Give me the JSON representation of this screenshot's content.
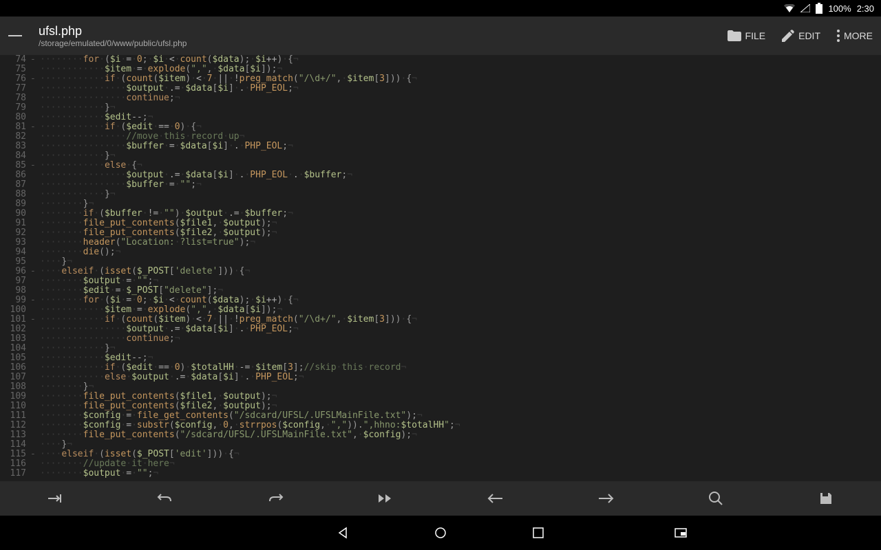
{
  "status": {
    "battery": "100%",
    "time": "2:30"
  },
  "header": {
    "title": "ufsl.php",
    "path": "/storage/emulated/0/www/public/ufsl.php",
    "actions": {
      "file": "FILE",
      "edit": "EDIT",
      "more": "MORE"
    }
  },
  "lines": [
    {
      "n": 74,
      "f": "-",
      "ind": 2,
      "html": "<span class='kw'>for</span><span class='ws'>·</span><span class='punc'>(</span><span class='var'>$i</span><span class='ws'>·</span><span class='op'>=</span><span class='ws'>·</span><span class='num'>0</span><span class='punc'>;</span><span class='ws'>·</span><span class='var'>$i</span><span class='ws'>·</span><span class='op'>&lt;</span><span class='ws'>·</span><span class='fn'>count</span><span class='punc'>(</span><span class='var'>$data</span><span class='punc'>);</span><span class='ws'>·</span><span class='var'>$i</span><span class='op'>++</span><span class='punc'>)</span><span class='ws'>·</span><span class='punc'>{</span><span class='nl'>¬</span>"
    },
    {
      "n": 75,
      "f": "",
      "ind": 3,
      "html": "<span class='var'>$item</span><span class='ws'>·</span><span class='op'>=</span><span class='ws'>·</span><span class='fn'>explode</span><span class='punc'>(</span><span class='str'>\",\"</span><span class='punc'>,</span><span class='ws'>·</span><span class='var'>$data</span><span class='punc'>[</span><span class='var'>$i</span><span class='punc'>]);</span><span class='nl'>¬</span>"
    },
    {
      "n": 76,
      "f": "-",
      "ind": 3,
      "html": "<span class='kw'>if</span><span class='ws'>·</span><span class='punc'>(</span><span class='fn'>count</span><span class='punc'>(</span><span class='var'>$item</span><span class='punc'>)</span><span class='ws'>·</span><span class='op'>&lt;</span><span class='ws'>·</span><span class='num'>7</span><span class='ws'>·</span><span class='op'>||</span><span class='ws'>·</span><span class='op'>!</span><span class='fn'>preg_match</span><span class='punc'>(</span><span class='str'>\"/\\d+/\"</span><span class='punc'>,</span><span class='ws'>·</span><span class='var'>$item</span><span class='punc'>[</span><span class='num'>3</span><span class='punc'>]))</span><span class='ws'>·</span><span class='punc'>{</span><span class='nl'>¬</span>"
    },
    {
      "n": 77,
      "f": "",
      "ind": 4,
      "html": "<span class='var'>$output</span><span class='ws'>·</span><span class='op'>.=</span><span class='ws'>·</span><span class='var'>$data</span><span class='punc'>[</span><span class='var'>$i</span><span class='punc'>]</span><span class='ws'>·</span><span class='op'>.</span><span class='ws'>·</span><span class='const'>PHP_EOL</span><span class='punc'>;</span><span class='nl'>¬</span>"
    },
    {
      "n": 78,
      "f": "",
      "ind": 4,
      "html": "<span class='kw'>continue</span><span class='punc'>;</span><span class='nl'>¬</span>"
    },
    {
      "n": 79,
      "f": "",
      "ind": 3,
      "html": "<span class='punc'>}</span><span class='nl'>¬</span>"
    },
    {
      "n": 80,
      "f": "",
      "ind": 3,
      "html": "<span class='var'>$edit</span><span class='op'>--</span><span class='punc'>;</span><span class='nl'>¬</span>"
    },
    {
      "n": 81,
      "f": "-",
      "ind": 3,
      "html": "<span class='kw'>if</span><span class='ws'>·</span><span class='punc'>(</span><span class='var'>$edit</span><span class='ws'>·</span><span class='op'>==</span><span class='ws'>·</span><span class='num'>0</span><span class='punc'>)</span><span class='ws'>·</span><span class='punc'>{</span><span class='nl'>¬</span>"
    },
    {
      "n": 82,
      "f": "",
      "ind": 4,
      "html": "<span class='cmt'>//move</span><span class='ws'>·</span><span class='cmt'>this</span><span class='ws'>·</span><span class='cmt'>record</span><span class='ws'>·</span><span class='cmt'>up</span><span class='nl'>¬</span>"
    },
    {
      "n": 83,
      "f": "",
      "ind": 4,
      "html": "<span class='var'>$buffer</span><span class='ws'>·</span><span class='op'>=</span><span class='ws'>·</span><span class='var'>$data</span><span class='punc'>[</span><span class='var'>$i</span><span class='punc'>]</span><span class='ws'>·</span><span class='op'>.</span><span class='ws'>·</span><span class='const'>PHP_EOL</span><span class='punc'>;</span><span class='nl'>¬</span>"
    },
    {
      "n": 84,
      "f": "",
      "ind": 3,
      "html": "<span class='punc'>}</span><span class='nl'>¬</span>"
    },
    {
      "n": 85,
      "f": "-",
      "ind": 3,
      "html": "<span class='kw'>else</span><span class='ws'>·</span><span class='punc'>{</span><span class='nl'>¬</span>"
    },
    {
      "n": 86,
      "f": "",
      "ind": 4,
      "html": "<span class='var'>$output</span><span class='ws'>·</span><span class='op'>.=</span><span class='ws'>·</span><span class='var'>$data</span><span class='punc'>[</span><span class='var'>$i</span><span class='punc'>]</span><span class='ws'>·</span><span class='op'>.</span><span class='ws'>·</span><span class='const'>PHP_EOL</span><span class='ws'>·</span><span class='op'>.</span><span class='ws'>·</span><span class='var'>$buffer</span><span class='punc'>;</span><span class='nl'>¬</span>"
    },
    {
      "n": 87,
      "f": "",
      "ind": 4,
      "html": "<span class='var'>$buffer</span><span class='ws'>·</span><span class='op'>=</span><span class='ws'>·</span><span class='str'>\"\"</span><span class='punc'>;</span><span class='nl'>¬</span>"
    },
    {
      "n": 88,
      "f": "",
      "ind": 3,
      "html": "<span class='punc'>}</span><span class='nl'>¬</span>"
    },
    {
      "n": 89,
      "f": "",
      "ind": 2,
      "html": "<span class='punc'>}</span><span class='nl'>¬</span>"
    },
    {
      "n": 90,
      "f": "",
      "ind": 2,
      "html": "<span class='kw'>if</span><span class='ws'>·</span><span class='punc'>(</span><span class='var'>$buffer</span><span class='ws'>·</span><span class='op'>!=</span><span class='ws'>·</span><span class='str'>\"\"</span><span class='punc'>)</span><span class='ws'>·</span><span class='var'>$output</span><span class='ws'>·</span><span class='op'>.=</span><span class='ws'>·</span><span class='var'>$buffer</span><span class='punc'>;</span><span class='nl'>¬</span>"
    },
    {
      "n": 91,
      "f": "",
      "ind": 2,
      "html": "<span class='fn'>file_put_contents</span><span class='punc'>(</span><span class='var'>$file1</span><span class='punc'>,</span><span class='ws'>·</span><span class='var'>$output</span><span class='punc'>);</span><span class='nl'>¬</span>"
    },
    {
      "n": 92,
      "f": "",
      "ind": 2,
      "html": "<span class='fn'>file_put_contents</span><span class='punc'>(</span><span class='var'>$file2</span><span class='punc'>,</span><span class='ws'>·</span><span class='var'>$output</span><span class='punc'>);</span><span class='nl'>¬</span>"
    },
    {
      "n": 93,
      "f": "",
      "ind": 2,
      "html": "<span class='fn'>header</span><span class='punc'>(</span><span class='str'>\"Location:</span><span class='ws'>·</span><span class='str'>?list=true\"</span><span class='punc'>);</span><span class='nl'>¬</span>"
    },
    {
      "n": 94,
      "f": "",
      "ind": 2,
      "html": "<span class='fn'>die</span><span class='punc'>();</span><span class='nl'>¬</span>"
    },
    {
      "n": 95,
      "f": "",
      "ind": 1,
      "html": "<span class='punc'>}</span><span class='nl'>¬</span>"
    },
    {
      "n": 96,
      "f": "-",
      "ind": 1,
      "html": "<span class='kw'>elseif</span><span class='ws'>·</span><span class='punc'>(</span><span class='fn'>isset</span><span class='punc'>(</span><span class='var'>$_POST</span><span class='punc'>[</span><span class='str'>'delete'</span><span class='punc'>]))</span><span class='ws'>·</span><span class='punc'>{</span><span class='nl'>¬</span>"
    },
    {
      "n": 97,
      "f": "",
      "ind": 2,
      "html": "<span class='var'>$output</span><span class='ws'>·</span><span class='op'>=</span><span class='ws'>·</span><span class='str'>\"\"</span><span class='punc'>;</span><span class='nl'>¬</span>"
    },
    {
      "n": 98,
      "f": "",
      "ind": 2,
      "html": "<span class='var'>$edit</span><span class='ws'>·</span><span class='op'>=</span><span class='ws'>·</span><span class='var'>$_POST</span><span class='punc'>[</span><span class='str'>\"delete\"</span><span class='punc'>];</span><span class='nl'>¬</span>"
    },
    {
      "n": 99,
      "f": "-",
      "ind": 2,
      "html": "<span class='kw'>for</span><span class='ws'>·</span><span class='punc'>(</span><span class='var'>$i</span><span class='ws'>·</span><span class='op'>=</span><span class='ws'>·</span><span class='num'>0</span><span class='punc'>;</span><span class='ws'>·</span><span class='var'>$i</span><span class='ws'>·</span><span class='op'>&lt;</span><span class='ws'>·</span><span class='fn'>count</span><span class='punc'>(</span><span class='var'>$data</span><span class='punc'>);</span><span class='ws'>·</span><span class='var'>$i</span><span class='op'>++</span><span class='punc'>)</span><span class='ws'>·</span><span class='punc'>{</span><span class='nl'>¬</span>"
    },
    {
      "n": 100,
      "f": "",
      "ind": 3,
      "html": "<span class='var'>$item</span><span class='ws'>·</span><span class='op'>=</span><span class='ws'>·</span><span class='fn'>explode</span><span class='punc'>(</span><span class='str'>\",\"</span><span class='punc'>,</span><span class='ws'>·</span><span class='var'>$data</span><span class='punc'>[</span><span class='var'>$i</span><span class='punc'>]);</span><span class='nl'>¬</span>"
    },
    {
      "n": 101,
      "f": "-",
      "ind": 3,
      "html": "<span class='kw'>if</span><span class='ws'>·</span><span class='punc'>(</span><span class='fn'>count</span><span class='punc'>(</span><span class='var'>$item</span><span class='punc'>)</span><span class='ws'>·</span><span class='op'>&lt;</span><span class='ws'>·</span><span class='num'>7</span><span class='ws'>·</span><span class='op'>||</span><span class='ws'>·</span><span class='op'>!</span><span class='fn'>preg_match</span><span class='punc'>(</span><span class='str'>\"/\\d+/\"</span><span class='punc'>,</span><span class='ws'>·</span><span class='var'>$item</span><span class='punc'>[</span><span class='num'>3</span><span class='punc'>]))</span><span class='ws'>·</span><span class='punc'>{</span><span class='nl'>¬</span>"
    },
    {
      "n": 102,
      "f": "",
      "ind": 4,
      "html": "<span class='var'>$output</span><span class='ws'>·</span><span class='op'>.=</span><span class='ws'>·</span><span class='var'>$data</span><span class='punc'>[</span><span class='var'>$i</span><span class='punc'>]</span><span class='ws'>·</span><span class='op'>.</span><span class='ws'>·</span><span class='const'>PHP_EOL</span><span class='punc'>;</span><span class='nl'>¬</span>"
    },
    {
      "n": 103,
      "f": "",
      "ind": 4,
      "html": "<span class='kw'>continue</span><span class='punc'>;</span><span class='nl'>¬</span>"
    },
    {
      "n": 104,
      "f": "",
      "ind": 3,
      "html": "<span class='punc'>}</span><span class='nl'>¬</span>"
    },
    {
      "n": 105,
      "f": "",
      "ind": 3,
      "html": "<span class='var'>$edit</span><span class='op'>--</span><span class='punc'>;</span><span class='nl'>¬</span>"
    },
    {
      "n": 106,
      "f": "",
      "ind": 3,
      "html": "<span class='kw'>if</span><span class='ws'>·</span><span class='punc'>(</span><span class='var'>$edit</span><span class='ws'>·</span><span class='op'>==</span><span class='ws'>·</span><span class='num'>0</span><span class='punc'>)</span><span class='ws'>·</span><span class='var'>$totalHH</span><span class='ws'>·</span><span class='op'>-=</span><span class='ws'>·</span><span class='var'>$item</span><span class='punc'>[</span><span class='num'>3</span><span class='punc'>];</span><span class='cmt'>//skip</span><span class='ws'>·</span><span class='cmt'>this</span><span class='ws'>·</span><span class='cmt'>record</span><span class='nl'>¬</span>"
    },
    {
      "n": 107,
      "f": "",
      "ind": 3,
      "html": "<span class='kw'>else</span><span class='ws'>·</span><span class='var'>$output</span><span class='ws'>·</span><span class='op'>.=</span><span class='ws'>·</span><span class='var'>$data</span><span class='punc'>[</span><span class='var'>$i</span><span class='punc'>]</span><span class='ws'>·</span><span class='op'>.</span><span class='ws'>·</span><span class='const'>PHP_EOL</span><span class='punc'>;</span><span class='nl'>¬</span>"
    },
    {
      "n": 108,
      "f": "",
      "ind": 2,
      "html": "<span class='punc'>}</span><span class='nl'>¬</span>"
    },
    {
      "n": 109,
      "f": "",
      "ind": 2,
      "html": "<span class='fn'>file_put_contents</span><span class='punc'>(</span><span class='var'>$file1</span><span class='punc'>,</span><span class='ws'>·</span><span class='var'>$output</span><span class='punc'>);</span><span class='nl'>¬</span>"
    },
    {
      "n": 110,
      "f": "",
      "ind": 2,
      "html": "<span class='fn'>file_put_contents</span><span class='punc'>(</span><span class='var'>$file2</span><span class='punc'>,</span><span class='ws'>·</span><@/span><span class='var'>$output</span><span class='punc'>);</span><span class='nl'>¬</span>"
    },
    {
      "n": 111,
      "f": "",
      "ind": 2,
      "html": "<span class='var'>$config</span><span class='ws'>·</span><span class='op'>=</span><span class='ws'>·</span><span class='fn'>file_get_contents</span><span class='punc'>(</span><span class='str'>\"/sdcard/UFSL/.UFSLMainFile.txt\"</span><span class='punc'>);</span><span class='nl'>¬</span>"
    },
    {
      "n": 112,
      "f": "",
      "ind": 2,
      "html": "<span class='var'>$config</span><span class='ws'>·</span><span class='op'>=</span><span class='ws'>·</span><span class='fn'>substr</span><span class='punc'>(</span><span class='var'>$config</span><span class='punc'>,</span><span class='ws'>·</span><span class='num'>0</span><span class='punc'>,</span><span class='ws'>·</span><span class='fn'>strrpos</span><span class='punc'>(</span><span class='var'>$config</span><span class='punc'>,</span><span class='ws'>·</span><span class='str'>\",\"</span><span class='punc'>)).</span><span class='str'>\",hhno:</span><span class='var'>$totalHH</span><span class='str'>\"</span><span class='punc'>;</span><span class='nl'>¬</span>"
    },
    {
      "n": 113,
      "f": "",
      "ind": 2,
      "html": "<span class='fn'>file_put_contents</span><span class='punc'>(</span><span class='str'>\"/sdcard/UFSL/.UFSLMainFile.txt\"</span><span class='punc'>,</span><span class='ws'>·</span><span class='var'>$config</span><span class='punc'>);</span><span class='nl'>¬</span>"
    },
    {
      "n": 114,
      "f": "",
      "ind": 1,
      "html": "<span class='punc'>}</span><span class='nl'>¬</span>"
    },
    {
      "n": 115,
      "f": "-",
      "ind": 1,
      "html": "<span class='kw'>elseif</span><span class='ws'>·</span><span class='punc'>(</span><span class='fn'>isset</span><span class='punc'>(</span><span class='var'>$_POST</span><span class='punc'>[</span><span class='str'>'edit'</span><span class='punc'>]))</span><span class='ws'>·</span><span class='punc'>{</span><span class='nl'>¬</span>"
    },
    {
      "n": 116,
      "f": "",
      "ind": 2,
      "html": "<span class='cmt'>//update</span><span class='ws'>·</span><span class='cmt'>it</span><span class='ws'>·</span><span class='cmt'>here</span><span class='nl'>¬</span>"
    },
    {
      "n": 117,
      "f": "",
      "ind": 2,
      "html": "<span class='var'>$output</span><span class='ws'>·</span><span class='op'>=</span><span class='ws'>·</span><span class='str'>\"\"</span><span class='punc'>;</span><span class='nl'>¬</span>"
    }
  ]
}
